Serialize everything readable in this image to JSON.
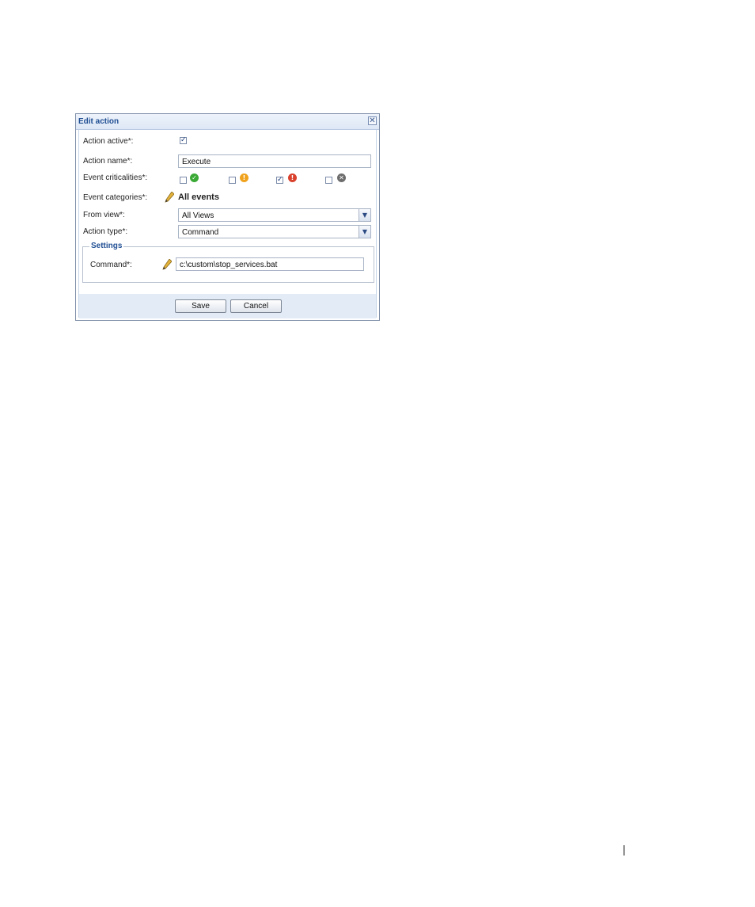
{
  "dialog": {
    "title": "Edit action",
    "close_glyph": "✕"
  },
  "form": {
    "action_active_label": "Action active*:",
    "action_active_checked": true,
    "action_name_label": "Action name*:",
    "action_name_value": "Execute",
    "event_criticalities_label": "Event criticalities*:",
    "criticalities": [
      {
        "icon": "ok-icon",
        "checked": false,
        "color": "#3aa935",
        "glyph": "✓"
      },
      {
        "icon": "warning-icon",
        "checked": false,
        "color": "#f0a21c",
        "glyph": "!"
      },
      {
        "icon": "error-icon",
        "checked": true,
        "color": "#d9412d",
        "glyph": "!"
      },
      {
        "icon": "unknown-icon",
        "checked": false,
        "color": "#6d6d6d",
        "glyph": "✕"
      }
    ],
    "event_categories_label": "Event categories*:",
    "event_categories_value": "All events",
    "from_view_label": "From view*:",
    "from_view_value": "All Views",
    "action_type_label": "Action type*:",
    "action_type_value": "Command"
  },
  "settings": {
    "legend": "Settings",
    "command_label": "Command*:",
    "command_value": "c:\\custom\\stop_services.bat"
  },
  "buttons": {
    "save": "Save",
    "cancel": "Cancel"
  },
  "checkmark_glyph": "✓"
}
